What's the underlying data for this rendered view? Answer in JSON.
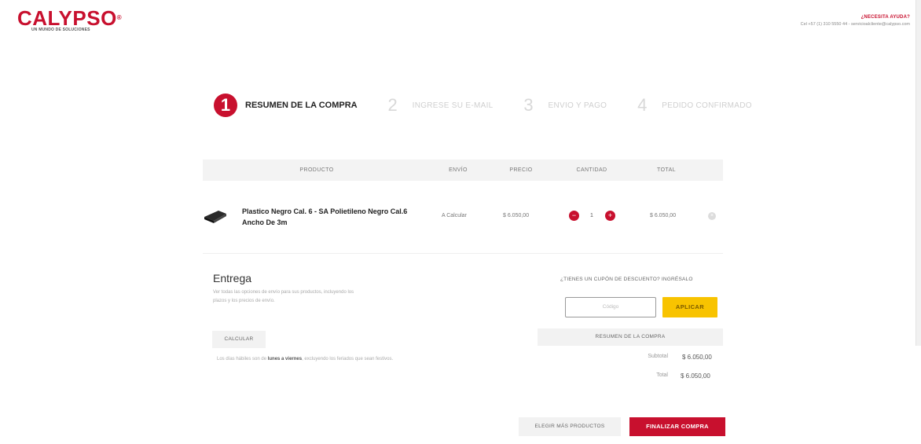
{
  "brand": {
    "name": "CALYPSO",
    "trademark": "®",
    "tagline": "UN MUNDO DE SOLUCIONES"
  },
  "help": {
    "title": "¿NECESITA AYUDA?",
    "contact": "Cel +57 (1) 310 5550 44 - servicioalcliente@calypso.com"
  },
  "steps": [
    {
      "number": "1",
      "label": "RESUMEN DE LA COMPRA",
      "active": true
    },
    {
      "number": "2",
      "label": "INGRESE SU E-MAIL",
      "active": false
    },
    {
      "number": "3",
      "label": "ENVIO Y PAGO",
      "active": false
    },
    {
      "number": "4",
      "label": "PEDIDO CONFIRMADO",
      "active": false
    }
  ],
  "table": {
    "headers": {
      "product": "PRODUCTO",
      "shipping": "ENVÍO",
      "price": "PRECIO",
      "quantity": "CANTIDAD",
      "total": "TOTAL"
    },
    "rows": [
      {
        "name": "Plastico Negro Cal. 6 - SA Polietileno Negro Cal.6 Ancho De 3m",
        "shipping": "A Calcular",
        "price": "$ 6.050,00",
        "quantity": "1",
        "total": "$ 6.050,00"
      }
    ]
  },
  "delivery": {
    "title": "Entrega",
    "description": "Ver todas las opciones de envío para sus productos, incluyendo los plazos y los precios de envío.",
    "calc_button": "CALCULAR",
    "note_prefix": "Los días hábiles son de ",
    "note_bold": "lunes a viernes",
    "note_suffix": ", excluyendo los feriados que sean festivos."
  },
  "coupon": {
    "question": "¿TIENES UN CUPÓN DE DESCUENTO? INGRÉSALO",
    "placeholder": "Código",
    "apply": "APLICAR"
  },
  "summary": {
    "title": "RESUMEN DE LA COMPRA",
    "subtotal_label": "Subtotal",
    "subtotal": "$ 6.050,00",
    "total_label": "Total",
    "total": "$ 6.050,00"
  },
  "actions": {
    "keep_shopping": "ELEGIR MÁS PRODUCTOS",
    "finish": "FINALIZAR COMPRA"
  },
  "colors": {
    "brand_red": "#c8102e",
    "apply_yellow": "#f8c300"
  },
  "icons": {
    "remove": "close-icon",
    "minus": "minus-icon",
    "plus": "plus-icon"
  }
}
